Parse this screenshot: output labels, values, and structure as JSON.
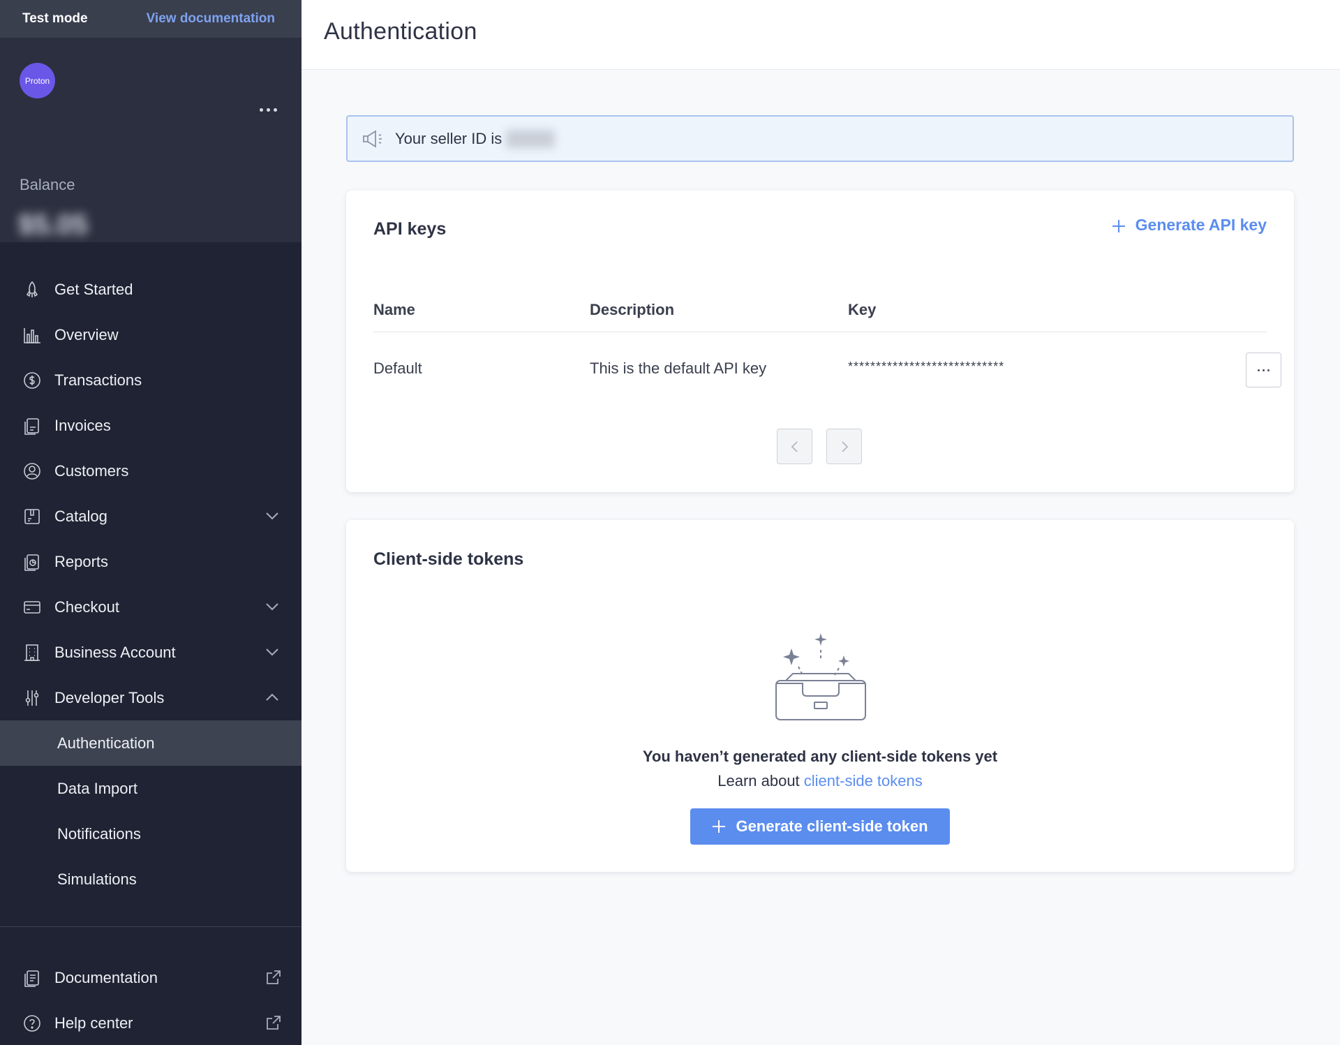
{
  "topbar": {
    "mode": "Test mode",
    "docs_link": "View documentation"
  },
  "account": {
    "avatar_text": "Proton",
    "balance_label": "Balance",
    "balance_value": "$5.05"
  },
  "nav": {
    "items": [
      {
        "label": "Get Started",
        "icon": "rocket-icon"
      },
      {
        "label": "Overview",
        "icon": "bar-chart-icon"
      },
      {
        "label": "Transactions",
        "icon": "dollar-circle-icon"
      },
      {
        "label": "Invoices",
        "icon": "invoice-icon"
      },
      {
        "label": "Customers",
        "icon": "user-circle-icon"
      },
      {
        "label": "Catalog",
        "icon": "catalog-icon",
        "expandable": true
      },
      {
        "label": "Reports",
        "icon": "report-icon"
      },
      {
        "label": "Checkout",
        "icon": "credit-card-icon",
        "expandable": true
      },
      {
        "label": "Business Account",
        "icon": "building-icon",
        "expandable": true
      },
      {
        "label": "Developer Tools",
        "icon": "sliders-icon",
        "expanded": true
      }
    ],
    "sub_items": [
      {
        "label": "Authentication",
        "active": true
      },
      {
        "label": "Data Import"
      },
      {
        "label": "Notifications"
      },
      {
        "label": "Simulations"
      }
    ],
    "bottom": [
      {
        "label": "Documentation",
        "icon": "documentation-icon"
      },
      {
        "label": "Help center",
        "icon": "help-icon"
      }
    ]
  },
  "header": {
    "title": "Authentication"
  },
  "seller_banner": {
    "text": "Your seller ID is"
  },
  "api_keys": {
    "title": "API keys",
    "generate_label": "Generate API key",
    "columns": [
      "Name",
      "Description",
      "Key"
    ],
    "rows": [
      {
        "name": "Default",
        "description": "This is the default API key",
        "key": "****************************"
      }
    ]
  },
  "client_tokens": {
    "title": "Client-side tokens",
    "empty_title": "You haven’t generated any client-side tokens yet",
    "learn_prefix": "Learn about ",
    "learn_link": "client-side tokens",
    "button_label": "Generate client-side token"
  },
  "colors": {
    "sidebar": "#1f2333",
    "accent": "#5b8def",
    "active_item": "#3e4352"
  }
}
